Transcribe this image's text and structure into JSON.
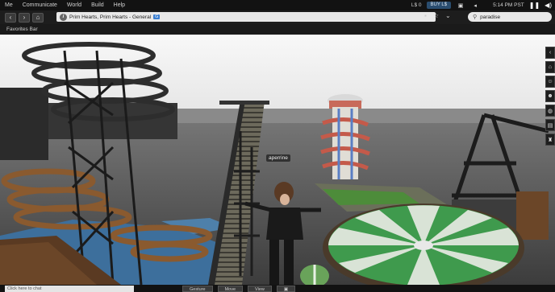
{
  "menu": {
    "items": [
      "Me",
      "Communicate",
      "World",
      "Build",
      "Help"
    ],
    "balance": "L$ 0",
    "buy_label": "BUY L$",
    "clock": "5:14 PM PST"
  },
  "nav": {
    "location": "Prim Hearts, Prim Hearts - General",
    "location_badge": "G",
    "search_value": "paradise"
  },
  "favorites": {
    "label": "Favorites Bar"
  },
  "scene": {
    "avatar_name": "aperrine"
  },
  "bottom": {
    "chat_placeholder": "Click here to chat",
    "buttons": [
      "Gesture",
      "Move",
      "View"
    ]
  },
  "colors": {
    "sky": "#f1f1f1",
    "water": "#3d6f9c",
    "carousel_green": "#3f9a4d"
  }
}
